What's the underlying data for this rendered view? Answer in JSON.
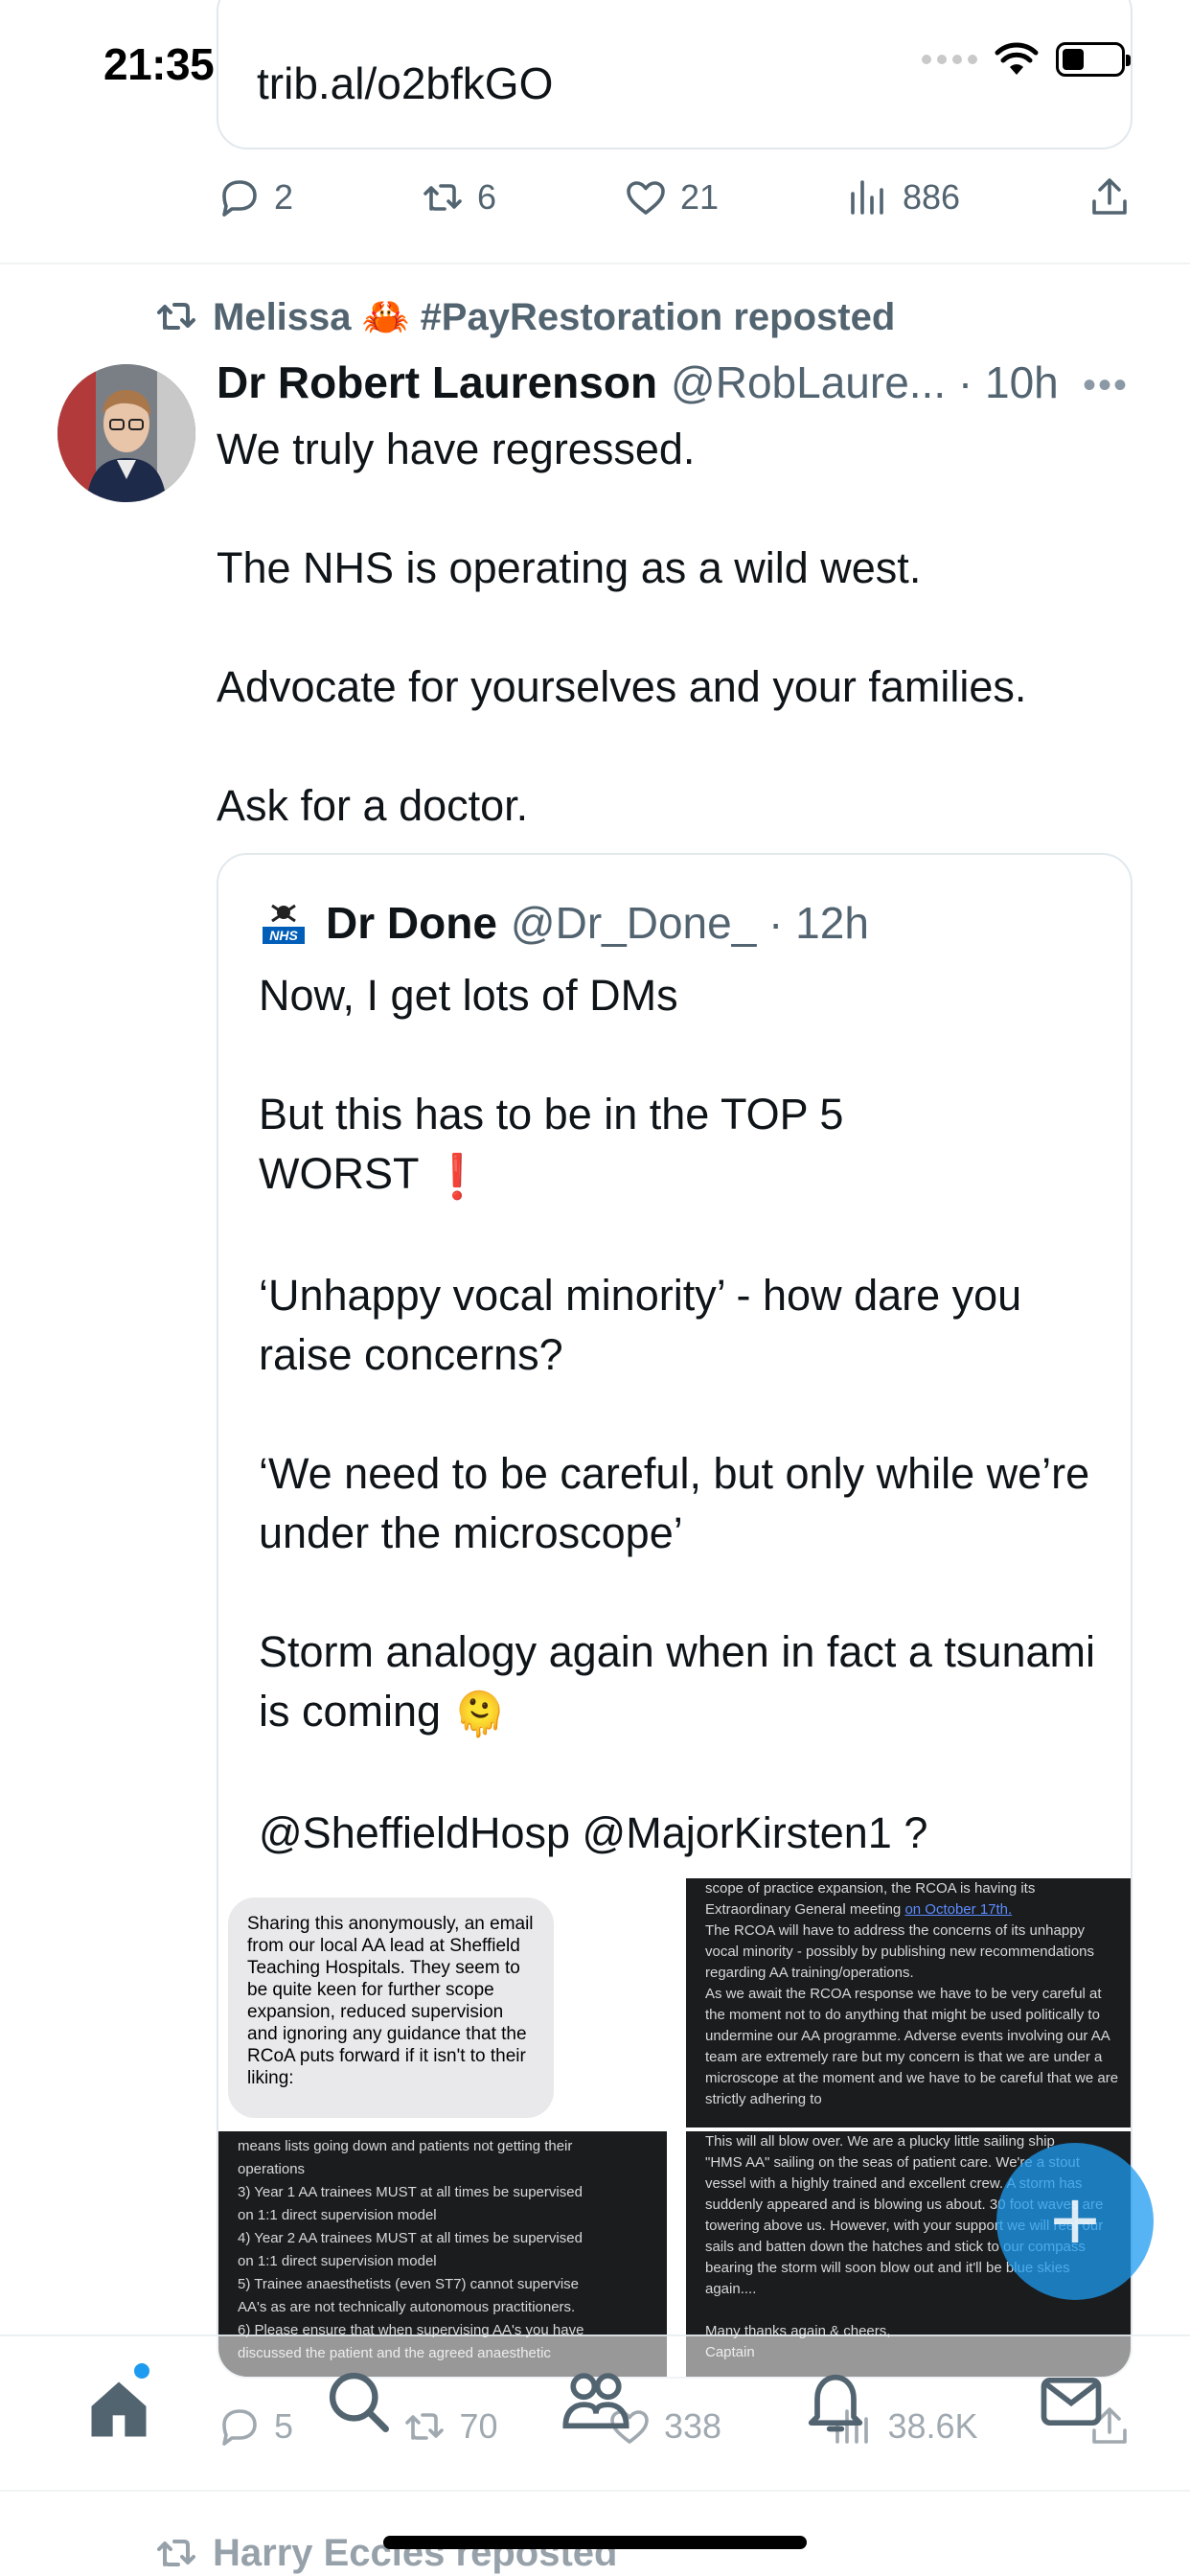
{
  "status_bar": {
    "time": "21:35"
  },
  "previous_tweet": {
    "link": "trib.al/o2bfkGO",
    "stats": {
      "replies": "2",
      "reposts": "6",
      "likes": "21",
      "views": "886"
    }
  },
  "tweet": {
    "repost_label": "Melissa 🦀 #PayRestoration reposted",
    "author_name": "Dr Robert Laurenson",
    "handle_time": "@RobLaure... · 10h",
    "text": "We truly have regressed.\n\nThe NHS is operating as a wild west.\n\nAdvocate for yourselves and your families.\n\nAsk for a doctor.",
    "stats": {
      "replies": "5",
      "reposts": "70",
      "likes": "338",
      "views": "38.6K"
    }
  },
  "quote": {
    "author_name": "Dr Done",
    "handle_time": "@Dr_Done_ · 12h",
    "text_1": "Now, I get lots of DMs\n\nBut this has to be in the TOP 5\nWORST ",
    "emoji_exclaim": "❗",
    "text_2": "\n\n‘Unhappy vocal minority’ - how dare you raise concerns?\n\n‘We need to be careful, but only while we’re under the microscope’\n\nStorm analogy again when in fact a tsunami is coming ",
    "emoji_face": "🫠",
    "text_3": "\n\n@SheffieldHosp @MajorKirsten1 ?",
    "images": {
      "img1_bubble": "Sharing this anonymously, an email from our local AA lead at Sheffield Teaching Hospitals. They seem to be quite keen for further scope expansion, reduced supervision and ignoring any guidance that the RCoA puts forward if it isn't to their liking:",
      "img2_pre": "scope of practice expansion, the RCOA is having its\nExtraordinary General meeting ",
      "img2_link": "on October 17th.",
      "img2_post": "\nThe RCOA will have to address the concerns of its unhappy vocal minority - possibly by publishing new recommendations regarding AA training/operations.\nAs we await the RCOA response we have to be very careful at the moment not to do anything that might be used politically to undermine our AA programme. Adverse events involving our AA team are extremely rare but my concern is that we are under a microscope at the moment and we have to be careful that we are strictly adhering to",
      "img3_text": "      means lists going down and patients not getting their\n      operations\n3) Year 1 AA trainees MUST at all times be supervised\n      on 1:1 direct supervision model\n4) Year 2 AA trainees MUST at all times be supervised\n      on 1:1 direct supervision model\n5) Trainee anaesthetists (even ST7)  cannot supervise\n      AA's as are not technically autonomous practitioners.\n6) Please ensure that when supervising AA's you have\n      discussed the patient and the agreed anaesthetic",
      "img4_text": "This will all blow over. We are a plucky little sailing ship\n\"HMS AA\" sailing on the seas of patient care. We're a stout vessel with a highly trained and excellent crew. A storm has suddenly appeared and is blowing us about. 30 foot waves are towering above us. However, with your support we will reef our sails and batten down the hatches and stick to our compass bearing the storm will soon blow out and it'll be blue skies again....\n\nMany thanks again & cheers,\nCaptain"
    }
  },
  "next_item": {
    "repost_label": "Harry Eccles reposted"
  },
  "colors": {
    "accent": "#1d9bf0",
    "secondary_text": "#536471",
    "border": "#e1e8ed"
  },
  "icons": [
    "reply-icon",
    "repost-icon",
    "like-icon",
    "views-icon",
    "share-icon",
    "home-icon",
    "search-icon",
    "communities-icon",
    "notifications-icon",
    "messages-icon",
    "compose-icon"
  ]
}
